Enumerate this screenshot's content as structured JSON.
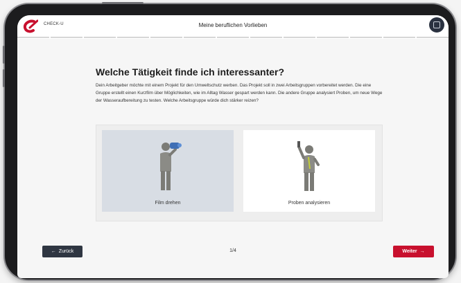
{
  "header": {
    "brand": "CHECK-U",
    "title": "Meine beruflichen Vorlieben"
  },
  "progress": {
    "segments": 13,
    "completed": 0
  },
  "question": {
    "heading": "Welche Tätigkeit finde ich interessanter?",
    "description": "Dein Arbeitgeber möchte mit einem Projekt für den Umweltschutz werben. Das Projekt soll in zwei Arbeitsgruppen vorbereitet werden. Die eine Gruppe erstellt einen Kurzfilm über Möglichkeiten, wie im Alltag Wasser gespart werden kann. Die andere Gruppe analysiert Proben, um neue Wege der Wasseraufbereitung zu testen. Welche Arbeitsgruppe würde dich stärker reizen?"
  },
  "options": [
    {
      "label": "Film drehen",
      "icon": "person-filming-icon",
      "selected": true
    },
    {
      "label": "Proben analysieren",
      "icon": "person-analyzing-icon",
      "selected": false
    }
  ],
  "footer": {
    "back_label": "Zurück",
    "back_arrow": "←",
    "page": "1/4",
    "next_label": "Weiter",
    "next_arrow": "→"
  },
  "colors": {
    "accent": "#c8102e",
    "back_button": "#2f3642",
    "selected_card": "#d8dde4"
  }
}
